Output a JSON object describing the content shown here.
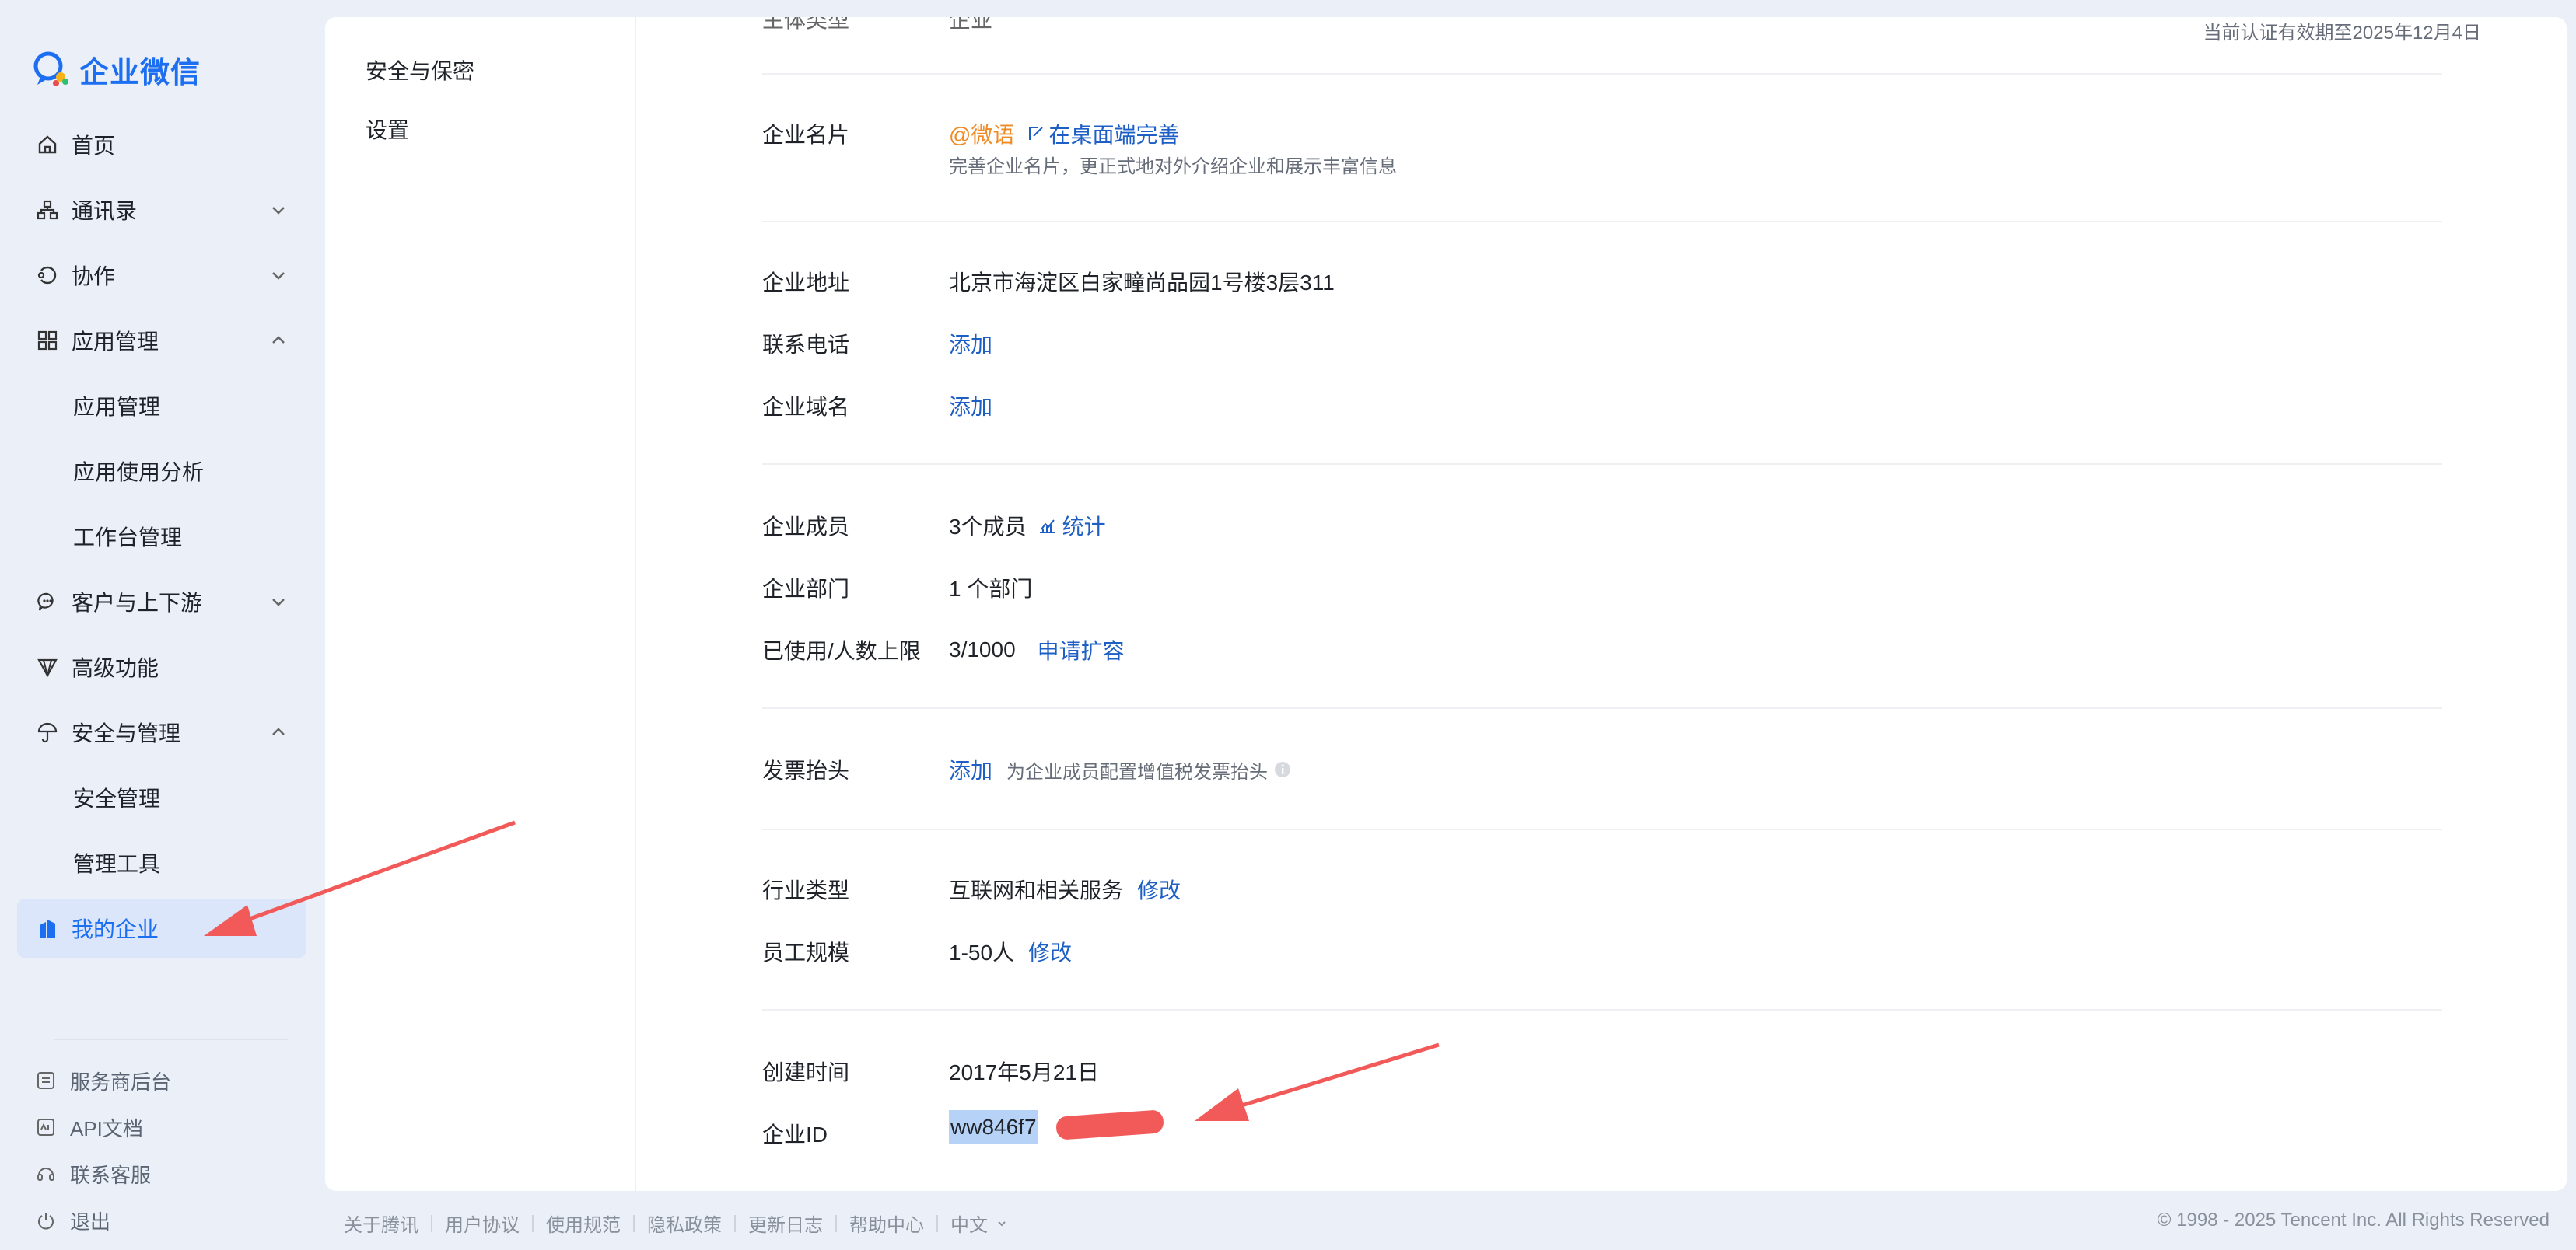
{
  "app": {
    "name": "企业微信",
    "brand_color": "#1d6ff2",
    "arrow_color": "#f25a5a"
  },
  "sidebar": {
    "items": [
      {
        "label": "首页",
        "icon": "home-icon"
      },
      {
        "label": "通讯录",
        "icon": "org-chart-icon"
      },
      {
        "label": "协作",
        "icon": "collaborate-icon"
      },
      {
        "label": "应用管理",
        "icon": "apps-grid-icon"
      },
      {
        "label": "应用管理"
      },
      {
        "label": "应用使用分析"
      },
      {
        "label": "工作台管理"
      },
      {
        "label": "客户与上下游",
        "icon": "chat-bubble-icon"
      },
      {
        "label": "高级功能",
        "icon": "diamond-icon"
      },
      {
        "label": "安全与管理",
        "icon": "umbrella-icon"
      },
      {
        "label": "安全管理"
      },
      {
        "label": "管理工具"
      },
      {
        "label": "我的企业",
        "icon": "building-icon"
      }
    ],
    "footer": [
      {
        "label": "服务商后台",
        "icon": "document-icon"
      },
      {
        "label": "API文档",
        "icon": "api-icon"
      },
      {
        "label": "联系客服",
        "icon": "headset-icon"
      },
      {
        "label": "退出",
        "icon": "power-icon"
      }
    ]
  },
  "subnav": {
    "items": [
      "安全与保密",
      "设置"
    ]
  },
  "content": {
    "top_partial_label": "主体类型",
    "top_partial_value": "企业",
    "cert_note": "当前认证有效期至2025年12月4日",
    "card": {
      "label": "企业名片",
      "at_name": "@微语",
      "desktop_link": "在桌面端完善",
      "hint": "完善企业名片，更正式地对外介绍企业和展示丰富信息"
    },
    "address": {
      "label": "企业地址",
      "value": "北京市海淀区白家疃尚品园1号楼3层311"
    },
    "phone": {
      "label": "联系电话",
      "link": "添加"
    },
    "domain": {
      "label": "企业域名",
      "link": "添加"
    },
    "members": {
      "label": "企业成员",
      "value": "3个成员",
      "link": "统计"
    },
    "departments": {
      "label": "企业部门",
      "value": "1 个部门"
    },
    "quota": {
      "label": "已使用/人数上限",
      "value": "3/1000",
      "link": "申请扩容"
    },
    "invoice": {
      "label": "发票抬头",
      "link": "添加",
      "hint": "为企业成员配置增值税发票抬头"
    },
    "industry": {
      "label": "行业类型",
      "value": "互联网和相关服务",
      "link": "修改"
    },
    "scale": {
      "label": "员工规模",
      "value": "1-50人",
      "link": "修改"
    },
    "created": {
      "label": "创建时间",
      "value": "2017年5月21日"
    },
    "corp_id": {
      "label": "企业ID",
      "value": "ww846f7"
    }
  },
  "footer": {
    "links": [
      "关于腾讯",
      "用户协议",
      "使用规范",
      "隐私政策",
      "更新日志",
      "帮助中心",
      "中文"
    ],
    "copyright": "© 1998 - 2025 Tencent Inc. All Rights Reserved"
  }
}
